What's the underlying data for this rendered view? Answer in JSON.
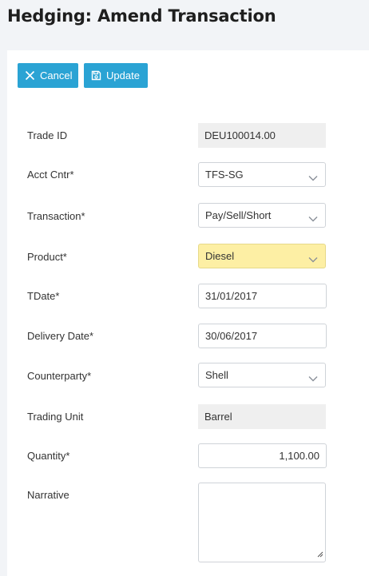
{
  "header": {
    "title": "Hedging: Amend Transaction"
  },
  "toolbar": {
    "cancel_label": "Cancel",
    "update_label": "Update"
  },
  "form": {
    "trade_id": {
      "label": "Trade ID",
      "value": "DEU100014.00"
    },
    "acct_cntr": {
      "label": "Acct Cntr*",
      "value": "TFS-SG"
    },
    "transaction": {
      "label": "Transaction*",
      "value": "Pay/Sell/Short"
    },
    "product": {
      "label": "Product*",
      "value": "Diesel"
    },
    "tdate": {
      "label": "TDate*",
      "value": "31/01/2017"
    },
    "delivery_date": {
      "label": "Delivery Date*",
      "value": "30/06/2017"
    },
    "counterparty": {
      "label": "Counterparty*",
      "value": "Shell"
    },
    "trading_unit": {
      "label": "Trading Unit",
      "value": "Barrel"
    },
    "quantity": {
      "label": "Quantity*",
      "value": "1,100.00"
    },
    "narrative": {
      "label": "Narrative",
      "value": ""
    }
  },
  "icons": {
    "cancel": "close-icon",
    "update": "save-icon",
    "dropdown": "chevron-down-icon"
  },
  "colors": {
    "button": "#2aa3d4",
    "highlight": "#fdefa4",
    "readonly": "#efefef",
    "background": "#f2f4f7"
  }
}
